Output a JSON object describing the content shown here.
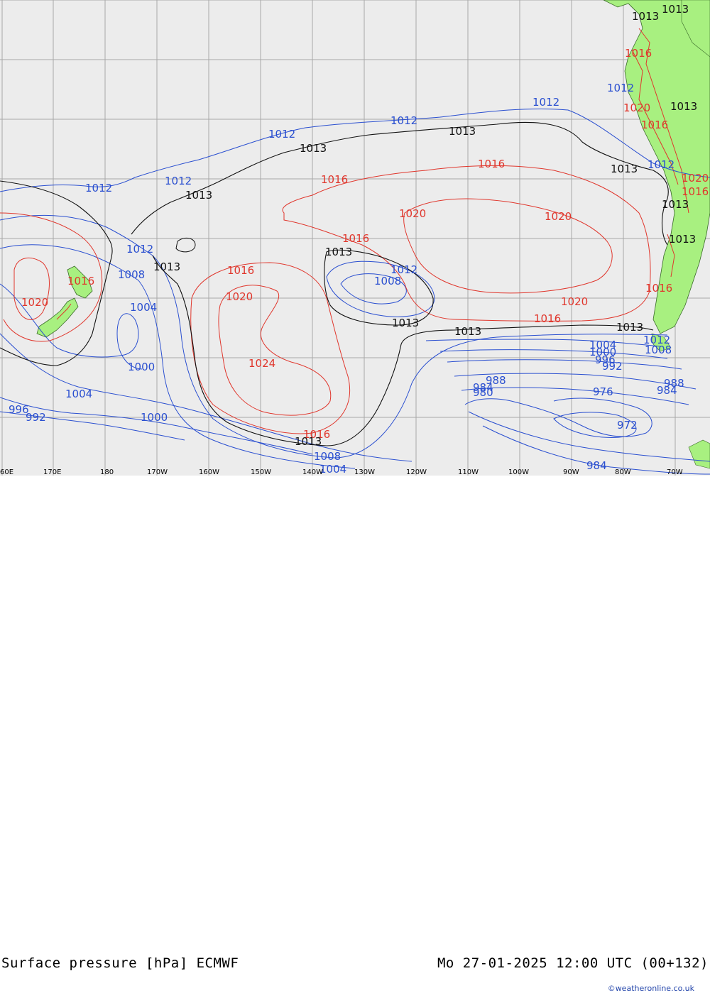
{
  "footer": {
    "title_left": "Surface pressure [hPa] ECMWF",
    "title_right": "Mo 27-01-2025 12:00 UTC (00+132)",
    "credit": "©weatheronline.co.uk"
  },
  "colors": {
    "ocean": "#ececec",
    "land": "#a8f080",
    "grid": "#a0a0a0",
    "isobar_low": "#2a4fd0",
    "isobar_high": "#e0362c",
    "isobar_1013": "#111111"
  },
  "longitude_labels": [
    "60E",
    "170E",
    "180",
    "170W",
    "160W",
    "150W",
    "140W",
    "130W",
    "120W",
    "110W",
    "100W",
    "90W",
    "80W",
    "70W"
  ],
  "isobar_labels": {
    "blue": [
      "1012",
      "1012",
      "1012",
      "1012",
      "1012",
      "1012",
      "1012",
      "1008",
      "1004",
      "1000",
      "1004",
      "996",
      "992",
      "1000",
      "1008",
      "1004",
      "1012",
      "1008",
      "1004",
      "1000",
      "996",
      "992",
      "988",
      "984",
      "988",
      "976",
      "972",
      "984",
      "980",
      "1012",
      "1008",
      "1012"
    ],
    "red": [
      "1016",
      "1020",
      "1016",
      "1016",
      "1020",
      "1020",
      "1016",
      "1020",
      "1024",
      "1016",
      "1016",
      "1020",
      "1016",
      "1016",
      "1020",
      "1016",
      "1016",
      "1020",
      "1016"
    ],
    "black": [
      "1013",
      "1013",
      "1013",
      "1013",
      "1013",
      "1013",
      "1013",
      "1013",
      "1013",
      "1013",
      "1013",
      "1013",
      "1013",
      "1013",
      "1013"
    ]
  }
}
